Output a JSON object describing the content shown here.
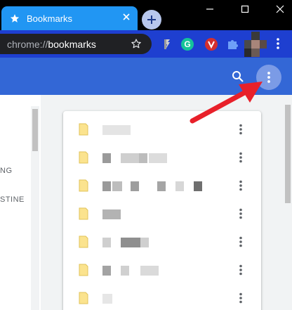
{
  "window": {
    "tab_title": "Bookmarks",
    "close_icon": "close-icon",
    "new_tab_icon": "plus-icon"
  },
  "toolbar": {
    "url_scheme": "chrome://",
    "url_host": "bookmarks",
    "star_icon": "star-icon",
    "extensions": [
      "feedly-icon",
      "grammarly-icon",
      "extension-v-icon",
      "puzzle-icon"
    ],
    "grammarly_letter": "G"
  },
  "header": {
    "search_icon": "search-icon",
    "menu_icon": "more-vert-icon"
  },
  "sidebar": {
    "labels": [
      "NG",
      "STINE"
    ]
  },
  "bookmarks": {
    "row_count": 7,
    "item_icon": "folder-icon",
    "row_menu_icon": "more-vert-icon"
  },
  "annotation": {
    "arrow_color": "#e8202a"
  },
  "colors": {
    "tab_active": "#2196f3",
    "toolbar": "#1e3fd0",
    "header": "#3367d6",
    "folder": "#fbe38e"
  }
}
